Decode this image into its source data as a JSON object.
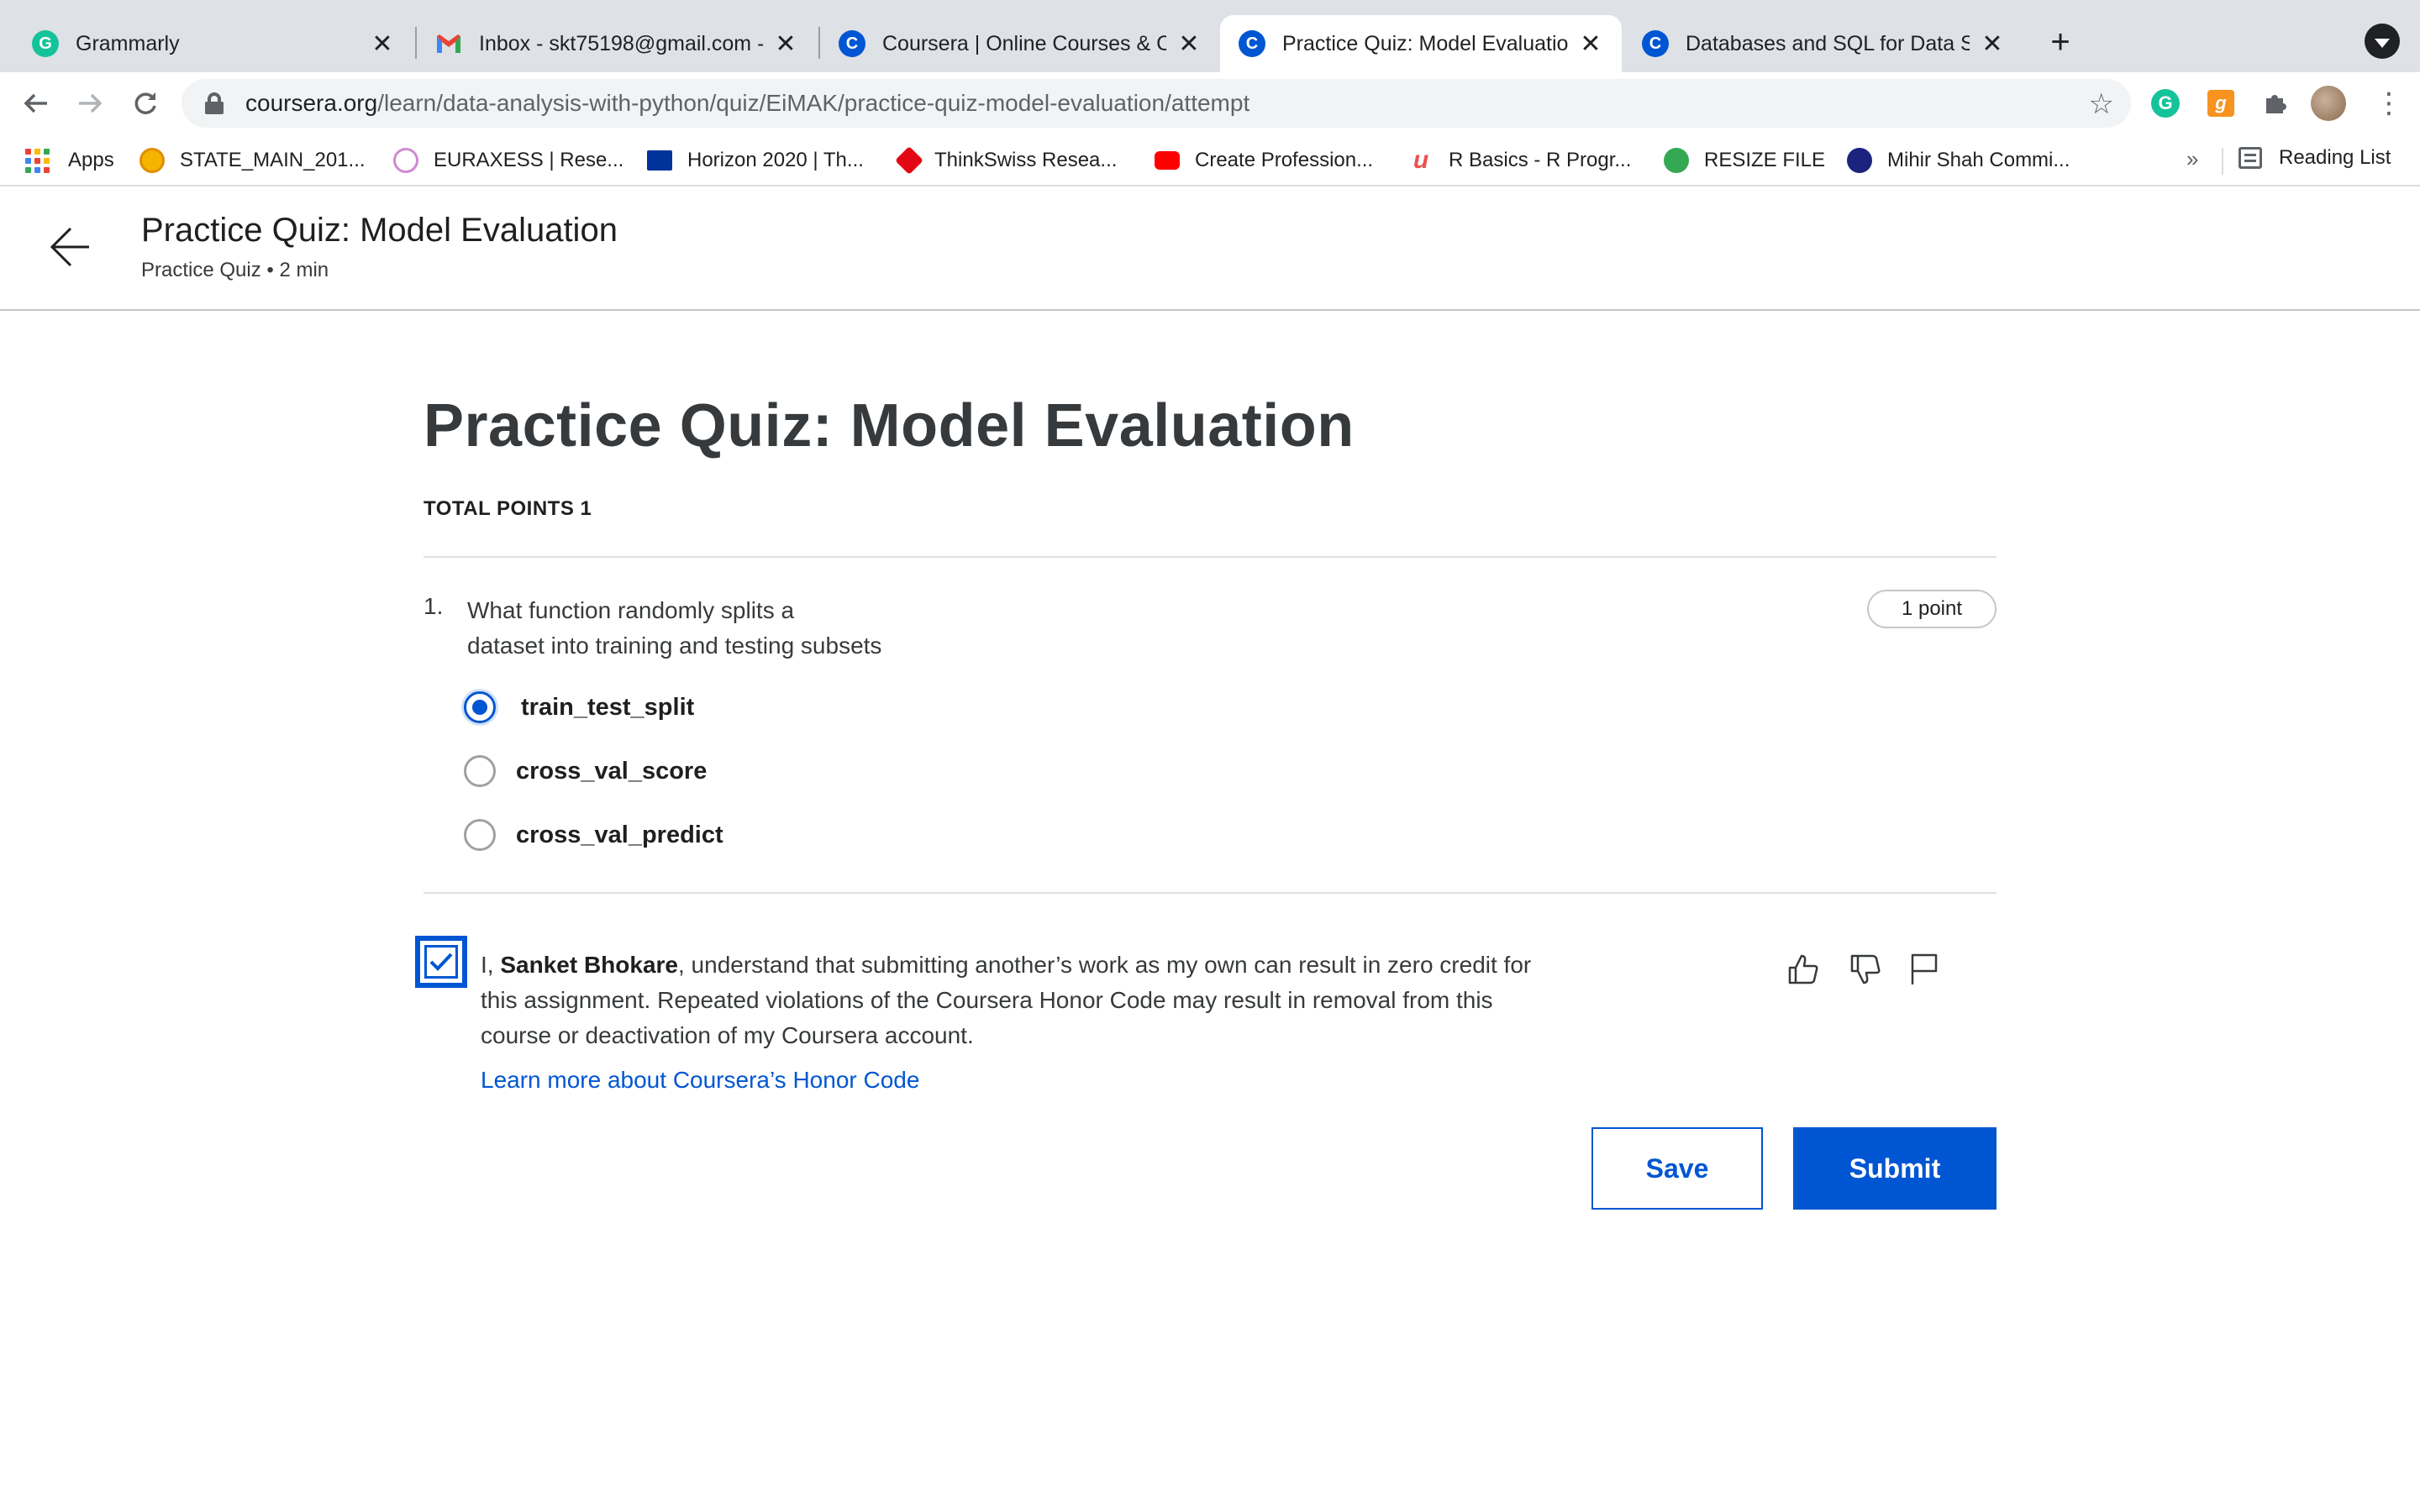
{
  "browser": {
    "tabs": [
      {
        "title": "Grammarly",
        "icon": "grammarly-icon",
        "color": "#15c39a",
        "letter": "G"
      },
      {
        "title": "Inbox - skt75198@gmail.com - ",
        "icon": "gmail-icon",
        "color": "#ea4335",
        "letter": "M"
      },
      {
        "title": "Coursera | Online Courses & Cr",
        "icon": "coursera-icon",
        "color": "#0056d2",
        "letter": "C"
      },
      {
        "title": "Practice Quiz: Model Evaluation",
        "icon": "coursera-icon",
        "color": "#0056d2",
        "letter": "C",
        "active": true
      },
      {
        "title": "Databases and SQL for Data Sc",
        "icon": "coursera-icon",
        "color": "#0056d2",
        "letter": "C"
      }
    ],
    "close_glyph": "✕",
    "new_tab_glyph": "+",
    "url_host": "coursera.org",
    "url_path": "/learn/data-analysis-with-python/quiz/EiMAK/practice-quiz-model-evaluation/attempt",
    "bookmarks": [
      {
        "label": "Apps",
        "icon": "apps-grid-icon"
      },
      {
        "label": "STATE_MAIN_201...",
        "icon": "state-icon",
        "color": "#f4b400"
      },
      {
        "label": "EURAXESS | Rese...",
        "icon": "euraxess-icon",
        "color": "#e0a0d0"
      },
      {
        "label": "Horizon 2020 | Th...",
        "icon": "eu-flag-icon",
        "color": "#003399"
      },
      {
        "label": "ThinkSwiss Resea...",
        "icon": "thinkswiss-icon",
        "color": "#e30613"
      },
      {
        "label": "Create Profession...",
        "icon": "youtube-icon",
        "color": "#ff0000"
      },
      {
        "label": "R Basics - R Progr...",
        "icon": "udemy-icon",
        "color": "#ec5252"
      },
      {
        "label": "RESIZE FILE",
        "icon": "resize-file-icon",
        "color": "#34a853"
      },
      {
        "label": "Mihir Shah Commi...",
        "icon": "mihir-icon",
        "color": "#1a237e"
      }
    ],
    "more_bookmarks": "»",
    "reading_list": "Reading List"
  },
  "header": {
    "title": "Practice Quiz: Model Evaluation",
    "subtitle": "Practice Quiz • 2 min"
  },
  "quiz": {
    "title": "Practice Quiz: Model Evaluation",
    "total_points": "TOTAL POINTS 1",
    "question": {
      "number": "1.",
      "text_line1": "What function randomly splits a",
      "text_line2": "dataset into training and testing subsets",
      "points": "1 point",
      "options": [
        {
          "label": "train_test_split",
          "selected": true
        },
        {
          "label": "cross_val_score",
          "selected": false
        },
        {
          "label": "cross_val_predict",
          "selected": false
        }
      ]
    },
    "honor": {
      "prefix": "I, ",
      "name": "Sanket Bhokare",
      "line1_rest": ", understand that submitting another’s work as my own can result in zero credit for",
      "line2": "this assignment. Repeated violations of the Coursera Honor Code may result in removal from this",
      "line3": "course or deactivation of my Coursera account.",
      "link": "Learn more about Coursera’s Honor Code",
      "checked": true
    },
    "save_label": "Save",
    "submit_label": "Submit"
  },
  "colors": {
    "accent": "#0056d2",
    "tabstrip": "#dee1e6"
  }
}
